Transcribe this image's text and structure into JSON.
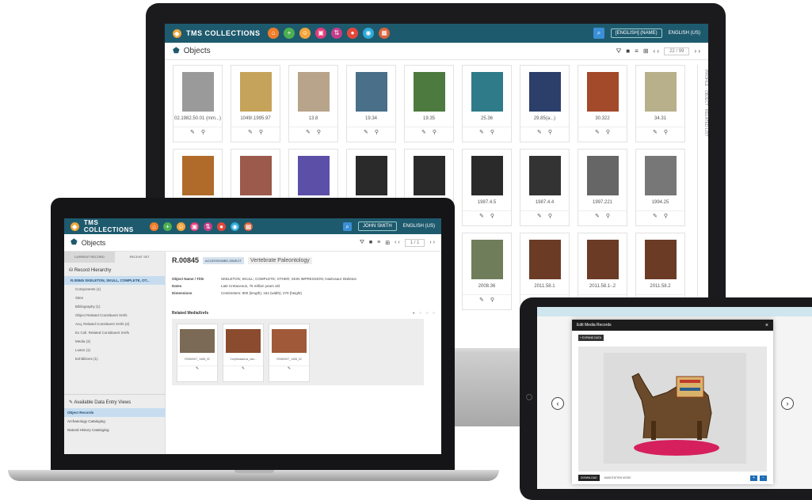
{
  "app": {
    "brand": "TMS COLLECTIONS",
    "user": "[ENGLISH] (NAME)",
    "language": "ENGLISH (US)"
  },
  "colors": {
    "topbar": "#1e5a6e",
    "accent": "#3a8fd6",
    "selected": "#c7dcef"
  },
  "module_icons": [
    {
      "name": "home-icon",
      "glyph": "⌂",
      "color": "#f07d2a"
    },
    {
      "name": "add-icon",
      "glyph": "+",
      "color": "#4caf50"
    },
    {
      "name": "people-icon",
      "glyph": "☺",
      "color": "#f3a43b"
    },
    {
      "name": "media-icon",
      "glyph": "▣",
      "color": "#e33c7a"
    },
    {
      "name": "transfer-icon",
      "glyph": "⇅",
      "color": "#c43d8a"
    },
    {
      "name": "cart-icon",
      "glyph": "●",
      "color": "#e2483a"
    },
    {
      "name": "globe-icon",
      "glyph": "◉",
      "color": "#2eaad8"
    },
    {
      "name": "calendar-icon",
      "glyph": "▦",
      "color": "#d9633c"
    }
  ],
  "monitor": {
    "page_title": "Objects",
    "pager": "22 / 99",
    "side_label": "PROFILE · OBJECT · RELATED LIST",
    "objects": [
      {
        "num": "02.1982.50.01 (mm...)",
        "color": "#9a9a9a"
      },
      {
        "num": "1049/.1995.97",
        "color": "#c6a35a"
      },
      {
        "num": "13.8",
        "color": "#b7a48a"
      },
      {
        "num": "19.34",
        "color": "#4a6f88"
      },
      {
        "num": "19.35",
        "color": "#4d7a3e"
      },
      {
        "num": "25.36",
        "color": "#2f7b8a"
      },
      {
        "num": "29.85(a...)",
        "color": "#2b3f6a"
      },
      {
        "num": "30.322",
        "color": "#a34a2a"
      },
      {
        "num": "34.31",
        "color": "#b8b08a"
      },
      {
        "num": "",
        "color": "#b06b2a"
      },
      {
        "num": "",
        "color": "#9b5a4b"
      },
      {
        "num": "",
        "color": "#5b4fa8"
      },
      {
        "num": "",
        "color": "#2a2a2a"
      },
      {
        "num": "",
        "color": "#2a2a2a"
      },
      {
        "num": "1987.4.5",
        "color": "#2a2a2a"
      },
      {
        "num": "1987.4.4",
        "color": "#333333"
      },
      {
        "num": "1997.221",
        "color": "#666666"
      },
      {
        "num": "1994.25",
        "color": "#777777"
      },
      {
        "num": "",
        "color": "#ffffff"
      },
      {
        "num": "",
        "color": "#ffffff"
      },
      {
        "num": "",
        "color": "#ffffff"
      },
      {
        "num": "",
        "color": "#ffffff"
      },
      {
        "num": "",
        "color": "#ffffff"
      },
      {
        "num": "2008.36",
        "color": "#6f7d5a"
      },
      {
        "num": "2011.58.1",
        "color": "#6b3b25"
      },
      {
        "num": "2011.58.1-.2",
        "color": "#6b3b25"
      },
      {
        "num": "2011.58.2",
        "color": "#6b3b25"
      }
    ]
  },
  "laptop": {
    "page_title": "Objects",
    "user": "JOHN SMITH",
    "language": "ENGLISH (US)",
    "pager": "1 / 1",
    "tabs": [
      "CURRENT RECORD",
      "RECENT SET"
    ],
    "hierarchy_title": "Record Hierarchy",
    "hierarchy_items": [
      "R.00845 SKELETON, SKULL, COMPLETE, OT...",
      "Components (1)",
      "Sites",
      "Bibliography (1)",
      "Object Related Constituent Xrefs",
      "Acq. Related Constituent Xrefs (2)",
      "Ex Coll. Related Constituent Xrefs",
      "Media (3)",
      "Loans (1)",
      "Exhibitions (1)"
    ],
    "views_title": "Available Data Entry Views",
    "views": [
      "Object Records",
      "Archaeology Cataloging",
      "Natural History Cataloging"
    ],
    "object_id": "R.00845",
    "status_badge": "ACCESSIONED OBJECT",
    "object_name": "Vertebrate Paleontology",
    "fields": [
      {
        "label": "Object Name / Title",
        "value": "SKELETON; SKULL; COMPLETE; OTHER; SKIN IMPRESSION; Hadrosaur Skeleton"
      },
      {
        "label": "Dates",
        "value": "Late Cretaceous, 76 million years old"
      },
      {
        "label": "Dimensions",
        "value": "Centimeters: 800 (length); 154 (width); 270 (height)"
      }
    ],
    "related_media_title": "Related MediaXrefs",
    "media": [
      {
        "caption": "ROM2007_1408_22",
        "color": "#7b6a55"
      },
      {
        "caption": "Corythosaurus_cas...",
        "color": "#8a4b2e"
      },
      {
        "caption": "ROM2007_1408_22",
        "color": "#a05a3a"
      }
    ]
  },
  "tablet": {
    "modal_title": "Edit Media Records",
    "toggle_label": "+ EXPAND DATA",
    "footer_button": "DOWNLOAD",
    "footer_label": "ANNOTATION MODE"
  }
}
